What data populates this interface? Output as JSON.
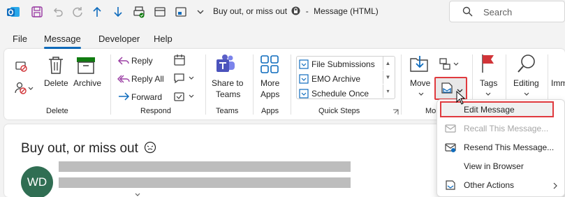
{
  "title": {
    "subject": "Buy out, or miss out",
    "window_type": "Message (HTML)",
    "search_placeholder": "Search"
  },
  "menu": {
    "tabs": [
      "File",
      "Message",
      "Developer",
      "Help"
    ],
    "active": "Message"
  },
  "ribbon": {
    "delete_group": {
      "delete": "Delete",
      "archive": "Archive",
      "group_label": "Delete"
    },
    "respond_group": {
      "reply": "Reply",
      "reply_all": "Reply All",
      "forward": "Forward",
      "group_label": "Respond"
    },
    "teams_group": {
      "share_line1": "Share to",
      "share_line2": "Teams",
      "group_label": "Teams"
    },
    "apps_group": {
      "more_line1": "More",
      "more_line2": "Apps",
      "group_label": "Apps"
    },
    "quick_steps": {
      "items": [
        "File Submissions",
        "EMO Archive",
        "Schedule Once"
      ],
      "group_label": "Quick Steps"
    },
    "move_group": {
      "move": "Move",
      "group_label_partial": "Mo"
    },
    "tags": {
      "label": "Tags"
    },
    "editing": {
      "label": "Editing"
    },
    "immersive_partial": "Imm"
  },
  "message": {
    "subject": "Buy out, or miss out",
    "avatar_initials": "WD"
  },
  "dropdown": {
    "items": [
      {
        "label": "Edit Message",
        "enabled": true,
        "highlighted": true
      },
      {
        "label": "Recall This Message...",
        "enabled": false
      },
      {
        "label": "Resend This Message...",
        "enabled": true
      },
      {
        "label": "View in Browser",
        "enabled": true
      },
      {
        "label": "Other Actions",
        "enabled": true,
        "submenu": true
      }
    ]
  },
  "colors": {
    "accent": "#0f6cbd",
    "highlight_red": "#e03a3e",
    "avatar": "#306e53",
    "outlook_blue": "#0f6cbd",
    "teams_purple": "#5b5fc7",
    "flag_red": "#d13438"
  }
}
